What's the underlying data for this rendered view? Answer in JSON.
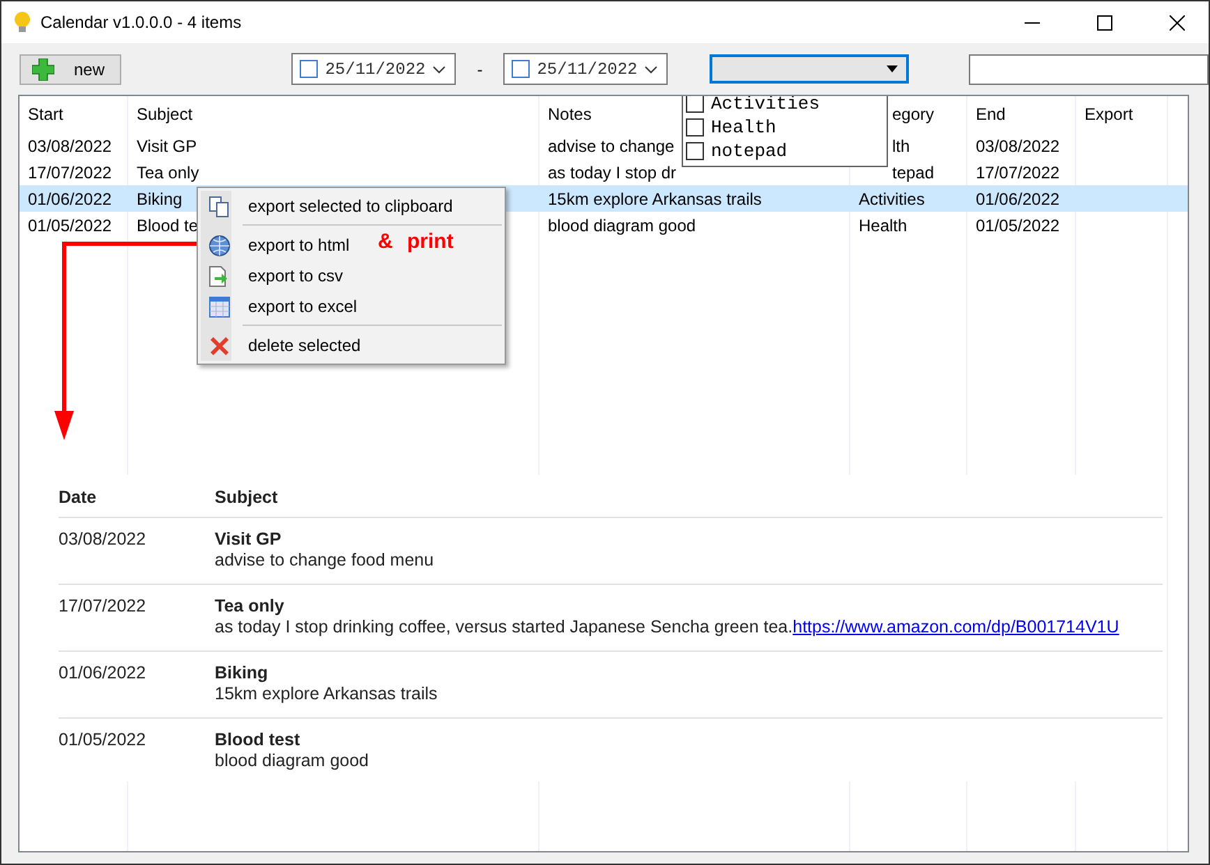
{
  "window": {
    "title": "Calendar v1.0.0.0 - 4 items"
  },
  "toolbar": {
    "new_button": "new",
    "date_from": {
      "value": "25/11/2022",
      "checked": false
    },
    "range_separator": "-",
    "date_to": {
      "value": "25/11/2022",
      "checked": false
    }
  },
  "table": {
    "columns": [
      "Start",
      "Subject",
      "Notes",
      "egory",
      "End",
      "Export"
    ],
    "rows": [
      {
        "cells": [
          "03/08/2022",
          "Visit GP",
          "advise to change",
          "lth",
          "03/08/2022",
          ""
        ],
        "selected": false
      },
      {
        "cells": [
          "17/07/2022",
          "Tea only",
          "as today I stop dr",
          "tepad",
          "17/07/2022",
          ""
        ],
        "selected": false
      },
      {
        "cells": [
          "01/06/2022",
          "Biking",
          "15km explore Arkansas trails",
          "Activities",
          "01/06/2022",
          ""
        ],
        "selected": true
      },
      {
        "cells": [
          "01/05/2022",
          "Blood te",
          "blood diagram good",
          "Health",
          "01/05/2022",
          ""
        ],
        "selected": false
      }
    ]
  },
  "category_dropdown": {
    "expanded": true,
    "options": [
      {
        "label": "Activities",
        "checked": false
      },
      {
        "label": "Health",
        "checked": false
      },
      {
        "label": "notepad",
        "checked": false
      }
    ]
  },
  "context_menu": {
    "items": [
      {
        "kind": "item",
        "label": "export selected to clipboard"
      },
      {
        "kind": "separator"
      },
      {
        "kind": "item",
        "label": "export to html"
      },
      {
        "kind": "item",
        "label": "export to csv"
      },
      {
        "kind": "item",
        "label": "export to excel"
      },
      {
        "kind": "separator"
      },
      {
        "kind": "item",
        "label": "delete selected"
      }
    ]
  },
  "annotation": {
    "text": "& print"
  },
  "preview": {
    "columns": [
      "Date",
      "Subject"
    ],
    "rows": [
      {
        "date": "03/08/2022",
        "subject": "Visit GP",
        "notes": "advise to change food menu"
      },
      {
        "date": "17/07/2022",
        "subject": "Tea only",
        "notes": "as today I stop drinking coffee, versus started Japanese Sencha green tea.",
        "link": "https://www.amazon.com/dp/B001714V1U"
      },
      {
        "date": "01/06/2022",
        "subject": "Biking",
        "notes": "15km explore Arkansas trails"
      },
      {
        "date": "01/05/2022",
        "subject": "Blood test",
        "notes": "blood diagram good"
      }
    ]
  }
}
